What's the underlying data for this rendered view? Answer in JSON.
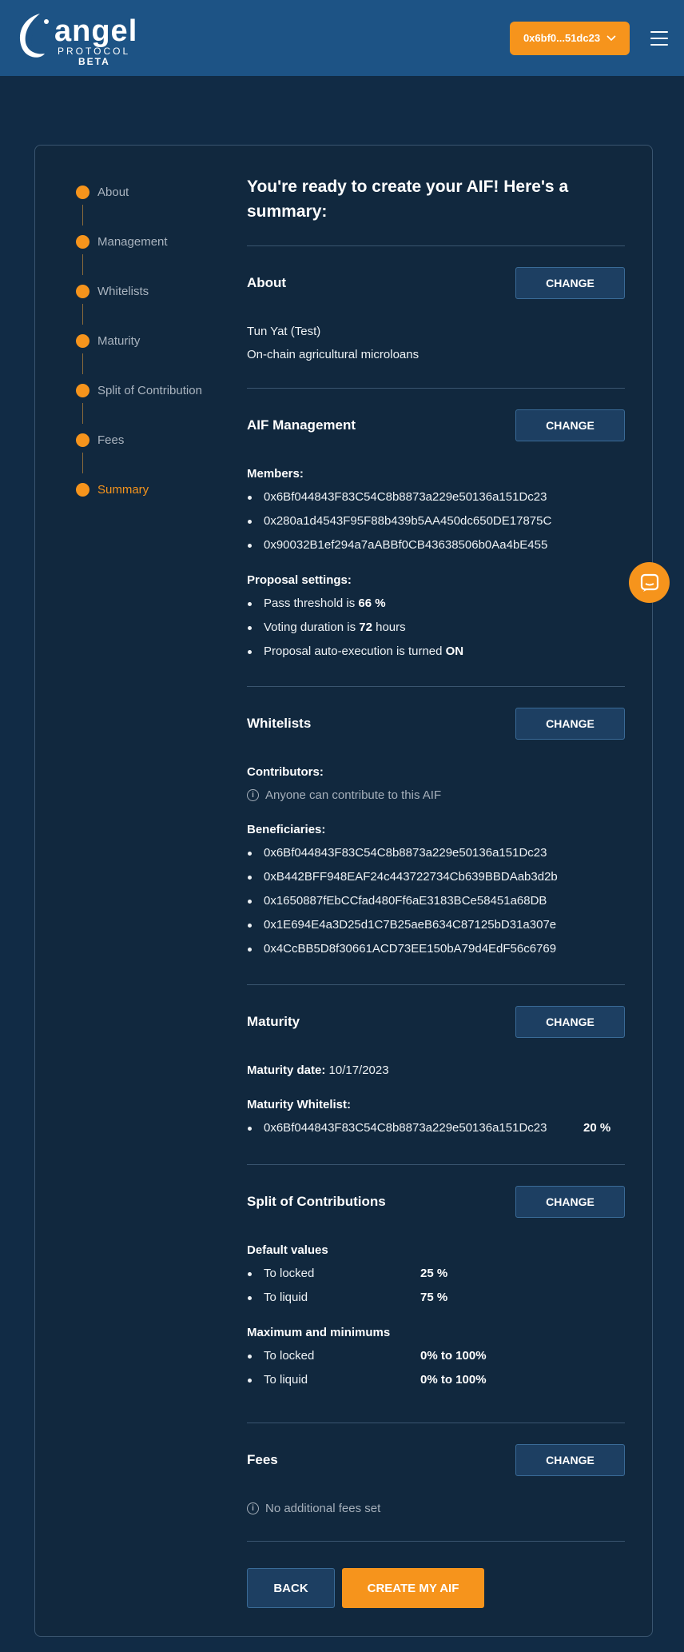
{
  "header": {
    "logo_word": "angel",
    "logo_sub": "PROTOCOL",
    "logo_beta": "BETA",
    "wallet_label": "0x6bf0...51dc23",
    "accent": "#f6941c",
    "bar_color": "#1d5385"
  },
  "stepper": {
    "steps": [
      {
        "label": "About"
      },
      {
        "label": "Management"
      },
      {
        "label": "Whitelists"
      },
      {
        "label": "Maturity"
      },
      {
        "label": "Split of Contribution"
      },
      {
        "label": "Fees"
      },
      {
        "label": "Summary"
      }
    ],
    "active": "Summary"
  },
  "summary": {
    "title": "You're ready to create your AIF! Here's a summary:",
    "change_label": "CHANGE",
    "about": {
      "title": "About",
      "name": "Tun Yat (Test)",
      "description": "On-chain agricultural microloans"
    },
    "management": {
      "title": "AIF Management",
      "members_label": "Members:",
      "members": [
        "0x6Bf044843F83C54C8b8873a229e50136a151Dc23",
        "0x280a1d4543F95F88b439b5AA450dc650DE17875C",
        "0x90032B1ef294a7aABBf0CB43638506b0Aa4bE455"
      ],
      "proposal_label": "Proposal settings:",
      "pass_prefix": "Pass threshold is ",
      "pass_value": "66 %",
      "voting_prefix": "Voting duration is ",
      "voting_value": "72",
      "voting_suffix": " hours",
      "auto_prefix": "Proposal auto-execution is turned ",
      "auto_value": "ON"
    },
    "whitelists": {
      "title": "Whitelists",
      "contributors_label": "Contributors:",
      "contributors_note": "Anyone can contribute to this AIF",
      "beneficiaries_label": "Beneficiaries:",
      "beneficiaries": [
        "0x6Bf044843F83C54C8b8873a229e50136a151Dc23",
        "0xB442BFF948EAF24c443722734Cb639BBDAab3d2b",
        "0x1650887fEbCCfad480Ff6aE3183BCe58451a68DB",
        "0x1E694E4a3D25d1C7B25aeB634C87125bD31a307e",
        "0x4CcBB5D8f30661ACD73EE150bA79d4EdF56c6769"
      ]
    },
    "maturity": {
      "title": "Maturity",
      "date_label": "Maturity date:",
      "date_value": "10/17/2023",
      "whitelist_label": "Maturity Whitelist:",
      "whitelist": [
        {
          "address": "0x6Bf044843F83C54C8b8873a229e50136a151Dc23",
          "share": "20 %"
        }
      ]
    },
    "split": {
      "title": "Split of Contributions",
      "defaults_label": "Default values",
      "locked_label": "To locked",
      "liquid_label": "To liquid",
      "default_locked": "25 %",
      "default_liquid": "75 %",
      "minmax_label": "Maximum and minimums",
      "minmax_locked": "0% to 100%",
      "minmax_liquid": "0% to 100%"
    },
    "fees": {
      "title": "Fees",
      "note": "No additional fees set"
    },
    "back_label": "BACK",
    "create_label": "CREATE MY AIF"
  }
}
